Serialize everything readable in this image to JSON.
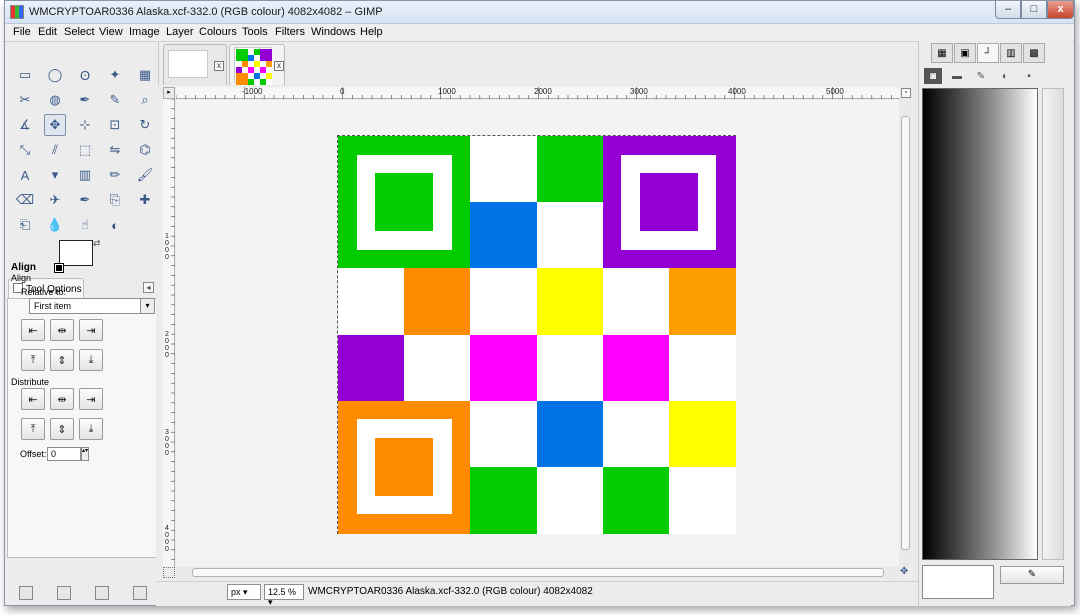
{
  "window": {
    "title": "WMCRYPTOAR0336 Alaska.xcf-332.0 (RGB colour) 4082x4082 – GIMP",
    "minimize_glyph": "–",
    "maximize_glyph": "□",
    "close_glyph": "x"
  },
  "menubar": {
    "items": [
      "File",
      "Edit",
      "Select",
      "View",
      "Image",
      "Layer",
      "Colours",
      "Tools",
      "Filters",
      "Windows",
      "Help"
    ]
  },
  "toolbox": {
    "tools": [
      "rect-select-icon",
      "ellipse-select-icon",
      "free-select-icon",
      "fuzzy-select-icon",
      "color-select-icon",
      "scissors-select-icon",
      "foreground-select-icon",
      "paths-icon",
      "color-picker-icon",
      "zoom-icon",
      "measure-icon",
      "move-icon",
      "align-icon",
      "crop-icon",
      "rotate-icon",
      "scale-icon",
      "shear-icon",
      "perspective-icon",
      "flip-icon",
      "cage-icon",
      "text-icon",
      "bucket-fill-icon",
      "blend-icon",
      "pencil-icon",
      "paintbrush-icon",
      "eraser-icon",
      "airbrush-icon",
      "ink-icon",
      "clone-icon",
      "heal-icon",
      "perspective-clone-icon",
      "blur-icon",
      "smudge-icon",
      "dodge-burn-icon"
    ],
    "swap_glyph": "⇄"
  },
  "tool_options": {
    "tab_label": "Tool Options",
    "tab_arrow": "◂",
    "heading": "Align",
    "subheading": "Align",
    "relative_label": "Relative to:",
    "relative_value": "First item",
    "relative_arrow": "▾",
    "distribute_label": "Distribute",
    "offset_label": "Offset:",
    "offset_value": "0",
    "offset_spin": "▴▾",
    "align_buttons": [
      "⇤",
      "⇹",
      "⇥",
      "⤒",
      "⇕",
      "⤓"
    ],
    "distribute_buttons": [
      "⇤",
      "⇹",
      "⇥",
      "⤒",
      "⇕",
      "⤓"
    ]
  },
  "image_tabs": [
    {
      "close": "x"
    },
    {
      "close": "x"
    }
  ],
  "rulers": {
    "horizontal": [
      "-1000",
      "0",
      "1000",
      "2000",
      "3000",
      "4000",
      "5000"
    ],
    "vertical": [
      "1000",
      "2000",
      "3000",
      "4000"
    ],
    "corner_glyph": "▸"
  },
  "canvas": {
    "zoom_toggle": "▫",
    "nav_glyph": "✥",
    "grid": [
      [
        "#00cc00",
        "#00cc00",
        "#ffffff",
        "#00cc00",
        "#9400d3",
        "#9400d3"
      ],
      [
        "#00cc00",
        "#00cc00",
        "#0073e6",
        "#ffffff",
        "#9400d3",
        "#9400d3"
      ],
      [
        "#ffffff",
        "#ff8c00",
        "#ffffff",
        "#ffff00",
        "#ffffff",
        "#ff9e00"
      ],
      [
        "#9400d3",
        "#ffffff",
        "#ff00ff",
        "#ffffff",
        "#ff00ff",
        "#ffffff"
      ],
      [
        "#ff8c00",
        "#ff8c00",
        "#ffffff",
        "#0073e6",
        "#ffffff",
        "#ffff00"
      ],
      [
        "#ff8c00",
        "#ff8c00",
        "#00cc00",
        "#ffffff",
        "#00cc00",
        "#ffffff"
      ]
    ],
    "finder_patterns": [
      {
        "color": "#00cc00",
        "row": 0,
        "col": 0
      },
      {
        "color": "#9400d3",
        "row": 0,
        "col": 4
      },
      {
        "color": "#ff8c00",
        "row": 4,
        "col": 0
      }
    ]
  },
  "statusbar": {
    "unit": "px",
    "unit_arrow": "▾",
    "zoom": "12.5 %",
    "zoom_arrow": "▾",
    "text": "WMCRYPTOAR0336 Alaska.xcf-332.0 (RGB colour) 4082x4082"
  },
  "dock": {
    "tabs": [
      "brushes-tab-icon",
      "patterns-tab-icon",
      "gradients-tab-icon",
      "fonts-tab-icon",
      "palettes-tab-icon"
    ],
    "row2": [
      "dock-tool-1-icon",
      "dock-tool-2-icon",
      "dock-tool-3-icon",
      "dock-tool-4-icon",
      "dock-tool-5-icon"
    ],
    "tab_glyphs": [
      "▦",
      "▣",
      "┘",
      "▥",
      "▩"
    ],
    "row2_glyphs": [
      "◙",
      "▬",
      "✎",
      "◐",
      "▪"
    ],
    "edit_glyph": "✎"
  }
}
